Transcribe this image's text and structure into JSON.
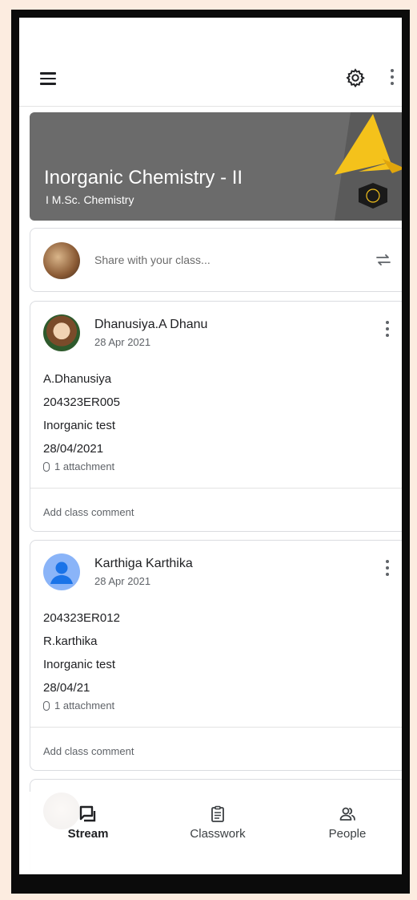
{
  "appbar": {
    "menu_icon": "hamburger-menu-icon",
    "settings_icon": "gear-icon",
    "overflow_icon": "more-vert-icon"
  },
  "banner": {
    "title": "Inorganic Chemistry - II",
    "subtitle": "I M.Sc. Chemistry",
    "background_color": "#6b6b6b",
    "accent_color": "#f4c21b"
  },
  "share": {
    "placeholder": "Share with your class...",
    "repost_icon": "repost-icon"
  },
  "posts": [
    {
      "author": "Dhanusiya.A Dhanu",
      "date": "28 Apr 2021",
      "lines": [
        "A.Dhanusiya",
        "204323ER005",
        "Inorganic test",
        "28/04/2021"
      ],
      "attachment": "1 attachment",
      "comment_placeholder": "Add class comment"
    },
    {
      "author": "Karthiga Karthika",
      "date": "28 Apr 2021",
      "lines": [
        "204323ER012",
        "R.karthika",
        "Inorganic test",
        "28/04/21"
      ],
      "attachment": "1 attachment",
      "comment_placeholder": "Add class comment"
    }
  ],
  "nav": {
    "stream": "Stream",
    "classwork": "Classwork",
    "people": "People",
    "active": "stream"
  }
}
